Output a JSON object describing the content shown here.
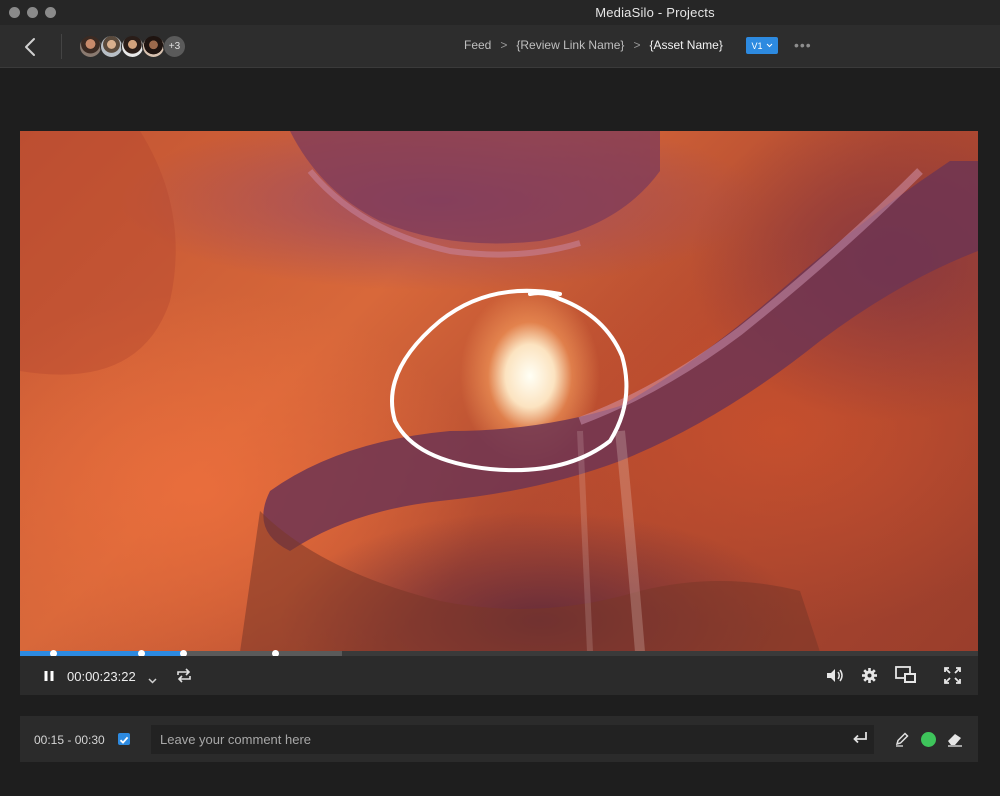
{
  "window": {
    "title": "MediaSilo  -  Projects"
  },
  "nav": {
    "more_participants": "+3",
    "breadcrumb": [
      {
        "label": "Feed"
      },
      {
        "label": "{Review Link Name}"
      },
      {
        "label": "{Asset Name}"
      }
    ],
    "version": "V1"
  },
  "player": {
    "timecode": "00:00:23:22",
    "progress_played": 0.17,
    "progress_buffered": 0.336,
    "comment_markers": [
      0.034,
      0.126,
      0.17,
      0.266
    ]
  },
  "comment": {
    "range": "00:15 - 00:30",
    "range_checked": true,
    "placeholder": "Leave your comment here",
    "draw_color": "#3ec45b"
  },
  "colors": {
    "accent": "#2d8ae0",
    "annotation_stroke": "#ffffff"
  }
}
